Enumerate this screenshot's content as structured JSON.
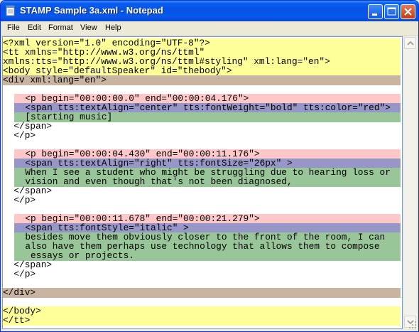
{
  "window": {
    "title": "STAMP Sample 3a.xml - Notepad"
  },
  "menu": {
    "items": [
      "File",
      "Edit",
      "Format",
      "View",
      "Help"
    ]
  },
  "editor": {
    "lines": [
      "<?xml version=\"1.0\" encoding=\"UTF-8\"?>",
      "<tt xmlns=\"http://www.w3.org/ns/ttml\"",
      "xmlns:tts=\"http://www.w3.org/ns/ttml#styling\" xml:lang=\"en\">",
      "<body style=\"defaultSpeaker\" id=\"thebody\">",
      "<div xml:lang=\"en\">",
      "",
      "  <p begin=\"00:00:00.0\" end=\"00:00:04.176\">",
      "  <span tts:textAlign=\"center\" tts:fontWeight=\"bold\" tts:color=\"red\">",
      "  [starting music]",
      "  </span>",
      "  </p>",
      "",
      "  <p begin=\"00:00:04.430\" end=\"00:00:11.176\">",
      "  <span tts:textAlign=\"right\" tts:fontSize=\"26px\" >",
      "  When I see a student who might be struggling due to hearing loss or",
      "  vision and even though that's not been diagnosed,",
      "  </span>",
      "  </p>",
      "",
      "  <p begin=\"00:00:11.678\" end=\"00:00:21.279\">",
      "  <span tts:fontStyle=\"italic\" >",
      "  besides move them obviously closer to the front of the room, I can",
      "  also have them perhaps use technology that allows them to compose",
      "   essays or projects.",
      "  </span>",
      "  </p>",
      "",
      "</div>",
      "",
      "</body>",
      "</tt>"
    ]
  },
  "colors": {
    "yellow": "#ffff99",
    "tan": "#c8b4a0",
    "pink": "#ffc8c8",
    "purple": "#9696c8",
    "green": "#99c699"
  }
}
